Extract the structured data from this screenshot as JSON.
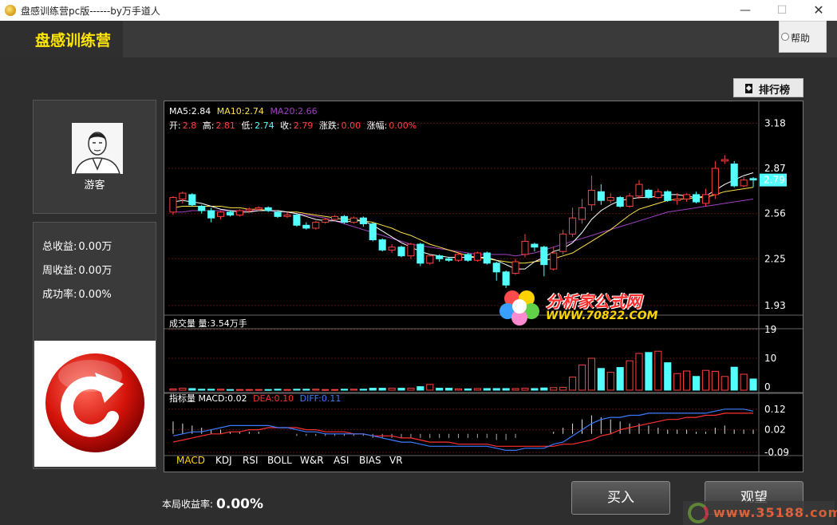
{
  "window": {
    "title": "盘感训练营pc版------by万手道人",
    "min": "—",
    "max": "☐",
    "close": "✕"
  },
  "header": {
    "brand": "盘感训练营",
    "help_label": "帮助"
  },
  "user": {
    "name": "游客"
  },
  "stats": [
    {
      "label": "总收益:",
      "value": "0.00万"
    },
    {
      "label": "周收益:",
      "value": "0.00万"
    },
    {
      "label": "成功率:",
      "value": "0.00%"
    }
  ],
  "rank_button": "排行榜",
  "ma_legend": {
    "ma5": "MA5:2.84",
    "ma10": "MA10:2.74",
    "ma20": "MA20:2.66"
  },
  "quote": {
    "open_label": "开:",
    "open": "2.8",
    "high_label": "高:",
    "high": "2.81",
    "low_label": "低:",
    "low": "2.74",
    "close_label": "收:",
    "close": "2.79",
    "chg_label": "涨跌:",
    "chg": "0.00",
    "pct_label": "涨幅:",
    "pct": "0.00%"
  },
  "volume_legend": "成交量 量:3.54万手",
  "macd_legend": {
    "name": "指标量 MACD:0.02",
    "dea": "DEA:0.10",
    "diff": "DIFF:0.11"
  },
  "indicator_tabs": [
    "MACD",
    "KDJ",
    "RSI",
    "BOLL",
    "W&R",
    "ASI",
    "BIAS",
    "VR"
  ],
  "active_indicator": "MACD",
  "profit": {
    "label": "本局收益率:",
    "value": "0.00%"
  },
  "buttons": {
    "buy": "买入",
    "watch": "观望"
  },
  "watermark": {
    "text1": "分析家公式网",
    "text2": "WWW.70822.COM",
    "bottom": "www.35188.com"
  },
  "colors": {
    "up": "#ff4040",
    "down": "#54ffff",
    "ma5": "#ffffff",
    "ma10": "#ffe24a",
    "ma20": "#a040c0",
    "dea": "#ff3030",
    "diff": "#3a7cff",
    "brand": "#ffe600"
  },
  "chart_data": {
    "type": "candlestick",
    "price_axis": {
      "ticks": [
        3.18,
        2.87,
        2.56,
        2.25,
        1.93
      ],
      "range": [
        1.88,
        3.22
      ],
      "current": 2.79
    },
    "volume_axis": {
      "ticks": [
        19,
        10,
        0
      ],
      "range": [
        0,
        19
      ]
    },
    "macd_axis": {
      "ticks": [
        0.12,
        0.02,
        -0.09
      ],
      "range": [
        -0.09,
        0.15
      ]
    },
    "candles": [
      [
        2.57,
        2.67,
        2.55,
        2.68
      ],
      [
        2.66,
        2.7,
        2.63,
        2.71
      ],
      [
        2.69,
        2.62,
        2.61,
        2.7
      ],
      [
        2.61,
        2.58,
        2.56,
        2.62
      ],
      [
        2.58,
        2.53,
        2.5,
        2.6
      ],
      [
        2.54,
        2.57,
        2.52,
        2.58
      ],
      [
        2.57,
        2.55,
        2.54,
        2.58
      ],
      [
        2.55,
        2.58,
        2.54,
        2.59
      ],
      [
        2.58,
        2.59,
        2.57,
        2.6
      ],
      [
        2.59,
        2.6,
        2.58,
        2.61
      ],
      [
        2.6,
        2.58,
        2.57,
        2.61
      ],
      [
        2.57,
        2.54,
        2.53,
        2.58
      ],
      [
        2.54,
        2.55,
        2.53,
        2.57
      ],
      [
        2.55,
        2.48,
        2.47,
        2.56
      ],
      [
        2.48,
        2.46,
        2.45,
        2.5
      ],
      [
        2.46,
        2.5,
        2.45,
        2.51
      ],
      [
        2.5,
        2.52,
        2.49,
        2.53
      ],
      [
        2.52,
        2.54,
        2.51,
        2.55
      ],
      [
        2.54,
        2.5,
        2.49,
        2.55
      ],
      [
        2.5,
        2.53,
        2.49,
        2.54
      ],
      [
        2.53,
        2.49,
        2.47,
        2.54
      ],
      [
        2.49,
        2.38,
        2.37,
        2.5
      ],
      [
        2.38,
        2.31,
        2.3,
        2.39
      ],
      [
        2.31,
        2.33,
        2.29,
        2.35
      ],
      [
        2.33,
        2.27,
        2.26,
        2.34
      ],
      [
        2.27,
        2.35,
        2.25,
        2.36
      ],
      [
        2.35,
        2.22,
        2.2,
        2.36
      ],
      [
        2.22,
        2.27,
        2.21,
        2.28
      ],
      [
        2.27,
        2.25,
        2.23,
        2.28
      ],
      [
        2.25,
        2.24,
        2.23,
        2.26
      ],
      [
        2.24,
        2.28,
        2.23,
        2.29
      ],
      [
        2.28,
        2.24,
        2.23,
        2.29
      ],
      [
        2.24,
        2.29,
        2.23,
        2.3
      ],
      [
        2.29,
        2.22,
        2.21,
        2.3
      ],
      [
        2.22,
        2.16,
        2.1,
        2.23
      ],
      [
        2.16,
        2.07,
        2.05,
        2.17
      ],
      [
        2.15,
        2.23,
        2.14,
        2.25
      ],
      [
        2.28,
        2.37,
        2.26,
        2.42
      ],
      [
        2.35,
        2.33,
        2.3,
        2.36
      ],
      [
        2.33,
        2.21,
        2.13,
        2.34
      ],
      [
        2.18,
        2.29,
        2.17,
        2.33
      ],
      [
        2.3,
        2.42,
        2.28,
        2.45
      ],
      [
        2.42,
        2.53,
        2.4,
        2.6
      ],
      [
        2.52,
        2.6,
        2.49,
        2.66
      ],
      [
        2.62,
        2.72,
        2.58,
        2.82
      ],
      [
        2.71,
        2.65,
        2.62,
        2.76
      ],
      [
        2.65,
        2.67,
        2.63,
        2.7
      ],
      [
        2.67,
        2.61,
        2.6,
        2.68
      ],
      [
        2.61,
        2.68,
        2.6,
        2.7
      ],
      [
        2.68,
        2.76,
        2.66,
        2.79
      ],
      [
        2.72,
        2.67,
        2.66,
        2.73
      ],
      [
        2.67,
        2.71,
        2.66,
        2.73
      ],
      [
        2.71,
        2.65,
        2.64,
        2.72
      ],
      [
        2.65,
        2.66,
        2.62,
        2.7
      ],
      [
        2.66,
        2.69,
        2.64,
        2.7
      ],
      [
        2.69,
        2.64,
        2.63,
        2.71
      ],
      [
        2.63,
        2.69,
        2.61,
        2.73
      ],
      [
        2.69,
        2.87,
        2.66,
        2.92
      ],
      [
        2.92,
        2.93,
        2.9,
        2.96
      ],
      [
        2.9,
        2.75,
        2.74,
        2.92
      ],
      [
        2.75,
        2.79,
        2.74,
        2.81
      ],
      [
        2.8,
        2.79,
        2.74,
        2.81
      ]
    ],
    "ma5": [
      2.64,
      2.65,
      2.64,
      2.63,
      2.61,
      2.59,
      2.58,
      2.57,
      2.57,
      2.58,
      2.58,
      2.58,
      2.57,
      2.56,
      2.54,
      2.52,
      2.51,
      2.51,
      2.5,
      2.51,
      2.51,
      2.48,
      2.44,
      2.4,
      2.36,
      2.33,
      2.3,
      2.28,
      2.27,
      2.26,
      2.26,
      2.26,
      2.26,
      2.26,
      2.24,
      2.21,
      2.18,
      2.18,
      2.23,
      2.26,
      2.3,
      2.32,
      2.36,
      2.43,
      2.52,
      2.58,
      2.62,
      2.65,
      2.66,
      2.67,
      2.67,
      2.68,
      2.69,
      2.69,
      2.68,
      2.67,
      2.68,
      2.72,
      2.76,
      2.79,
      2.82,
      2.84
    ],
    "ma10": [
      2.6,
      2.61,
      2.61,
      2.61,
      2.61,
      2.61,
      2.6,
      2.6,
      2.59,
      2.59,
      2.58,
      2.58,
      2.57,
      2.57,
      2.56,
      2.55,
      2.54,
      2.53,
      2.52,
      2.52,
      2.51,
      2.5,
      2.48,
      2.46,
      2.43,
      2.41,
      2.38,
      2.35,
      2.33,
      2.31,
      2.29,
      2.27,
      2.26,
      2.25,
      2.24,
      2.23,
      2.22,
      2.22,
      2.23,
      2.24,
      2.25,
      2.27,
      2.29,
      2.33,
      2.37,
      2.41,
      2.45,
      2.5,
      2.55,
      2.59,
      2.61,
      2.63,
      2.65,
      2.66,
      2.66,
      2.67,
      2.67,
      2.69,
      2.71,
      2.72,
      2.73,
      2.74
    ],
    "ma20": [
      2.57,
      2.57,
      2.58,
      2.58,
      2.58,
      2.58,
      2.58,
      2.58,
      2.58,
      2.58,
      2.58,
      2.57,
      2.57,
      2.56,
      2.55,
      2.54,
      2.53,
      2.51,
      2.49,
      2.47,
      2.45,
      2.43,
      2.41,
      2.39,
      2.37,
      2.35,
      2.34,
      2.33,
      2.32,
      2.31,
      2.3,
      2.29,
      2.28,
      2.28,
      2.28,
      2.28,
      2.27,
      2.28,
      2.29,
      2.31,
      2.33,
      2.35,
      2.37,
      2.39,
      2.41,
      2.43,
      2.45,
      2.47,
      2.49,
      2.51,
      2.53,
      2.55,
      2.57,
      2.58,
      2.59,
      2.6,
      2.61,
      2.62,
      2.63,
      2.64,
      2.65,
      2.66
    ],
    "volume": [
      0.4,
      0.6,
      0.5,
      0.3,
      0.3,
      0.3,
      0.2,
      0.2,
      0.2,
      0.2,
      0.2,
      0.3,
      0.2,
      0.3,
      0.3,
      0.3,
      0.2,
      0.2,
      0.3,
      0.3,
      0.3,
      0.6,
      0.6,
      0.6,
      0.6,
      0.6,
      1.1,
      1.8,
      0.6,
      0.6,
      0.4,
      0.4,
      0.5,
      0.5,
      0.5,
      0.5,
      0.5,
      0.6,
      0.5,
      0.7,
      0.8,
      0.9,
      4.1,
      7.9,
      10.0,
      6.8,
      5.6,
      7.1,
      9.2,
      11.5,
      11.8,
      12.2,
      8.6,
      5.2,
      6.0,
      4.3,
      6.2,
      5.9,
      4.3,
      7.2,
      5.0,
      3.5
    ],
    "macd_hist": [
      0.06,
      0.05,
      0.04,
      0.03,
      0.02,
      0.02,
      0.01,
      0.01,
      0.01,
      0.01,
      0.0,
      0.0,
      0.0,
      -0.01,
      -0.01,
      -0.01,
      -0.01,
      -0.01,
      -0.01,
      -0.01,
      -0.01,
      -0.02,
      -0.02,
      -0.02,
      -0.02,
      -0.02,
      -0.02,
      -0.02,
      -0.02,
      -0.02,
      -0.02,
      -0.02,
      -0.02,
      -0.02,
      -0.03,
      -0.03,
      -0.02,
      0.0,
      0.0,
      0.0,
      0.01,
      0.03,
      0.05,
      0.07,
      0.09,
      0.08,
      0.07,
      0.06,
      0.05,
      0.05,
      0.04,
      0.03,
      0.02,
      0.02,
      0.02,
      0.01,
      0.01,
      0.03,
      0.04,
      0.02,
      0.02,
      0.02
    ],
    "macd_diff": [
      -0.01,
      0.0,
      0.01,
      0.01,
      0.02,
      0.03,
      0.04,
      0.04,
      0.04,
      0.04,
      0.04,
      0.03,
      0.03,
      0.02,
      0.01,
      0.01,
      0.0,
      0.0,
      0.0,
      0.0,
      0.0,
      -0.01,
      -0.02,
      -0.03,
      -0.04,
      -0.04,
      -0.05,
      -0.06,
      -0.06,
      -0.06,
      -0.06,
      -0.06,
      -0.06,
      -0.06,
      -0.07,
      -0.08,
      -0.08,
      -0.07,
      -0.07,
      -0.07,
      -0.05,
      -0.04,
      -0.01,
      0.02,
      0.05,
      0.07,
      0.08,
      0.08,
      0.09,
      0.09,
      0.1,
      0.1,
      0.1,
      0.1,
      0.1,
      0.1,
      0.1,
      0.11,
      0.12,
      0.12,
      0.12,
      0.11
    ],
    "macd_dea": [
      -0.04,
      -0.03,
      -0.02,
      -0.01,
      0.0,
      0.0,
      0.01,
      0.01,
      0.02,
      0.02,
      0.03,
      0.03,
      0.03,
      0.03,
      0.02,
      0.02,
      0.01,
      0.01,
      0.01,
      0.0,
      0.0,
      -0.01,
      -0.01,
      -0.01,
      -0.02,
      -0.02,
      -0.03,
      -0.04,
      -0.04,
      -0.04,
      -0.05,
      -0.05,
      -0.05,
      -0.05,
      -0.06,
      -0.06,
      -0.06,
      -0.06,
      -0.06,
      -0.06,
      -0.06,
      -0.05,
      -0.05,
      -0.04,
      -0.03,
      -0.01,
      0.0,
      0.02,
      0.03,
      0.04,
      0.05,
      0.06,
      0.07,
      0.07,
      0.08,
      0.08,
      0.09,
      0.09,
      0.1,
      0.1,
      0.1,
      0.1
    ]
  }
}
